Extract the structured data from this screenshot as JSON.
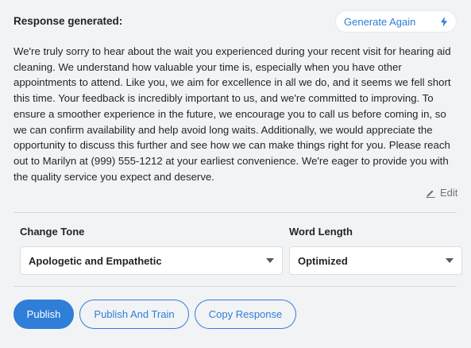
{
  "header": {
    "title": "Response generated:",
    "generate_again_label": "Generate Again"
  },
  "response": {
    "text": "We're truly sorry to hear about the wait you experienced during your recent visit for hearing aid cleaning. We understand how valuable your time is, especially when you have other appointments to attend. Like you, we aim for excellence in all we do, and it seems we fell short this time. Your feedback is incredibly important to us, and we're committed to improving. To ensure a smoother experience in the future, we encourage you to call us before coming in, so we can confirm availability and help avoid long waits. Additionally, we would appreciate the opportunity to discuss this further and see how we can make things right for you. Please reach out to Marilyn at (999) 555-1212 at your earliest convenience. We're eager to provide you with the quality service you expect and deserve.",
    "edit_label": "Edit"
  },
  "settings": {
    "tone_label": "Change Tone",
    "tone_value": "Apologetic and Empathetic",
    "length_label": "Word Length",
    "length_value": "Optimized"
  },
  "actions": {
    "publish": "Publish",
    "publish_and_train": "Publish And Train",
    "copy_response": "Copy Response"
  },
  "colors": {
    "accent": "#2f7ed8",
    "background": "#f2f3f5"
  },
  "icons": {
    "generate": "lightning-bolt-icon",
    "edit": "pencil-icon",
    "dropdown": "chevron-down-icon"
  }
}
